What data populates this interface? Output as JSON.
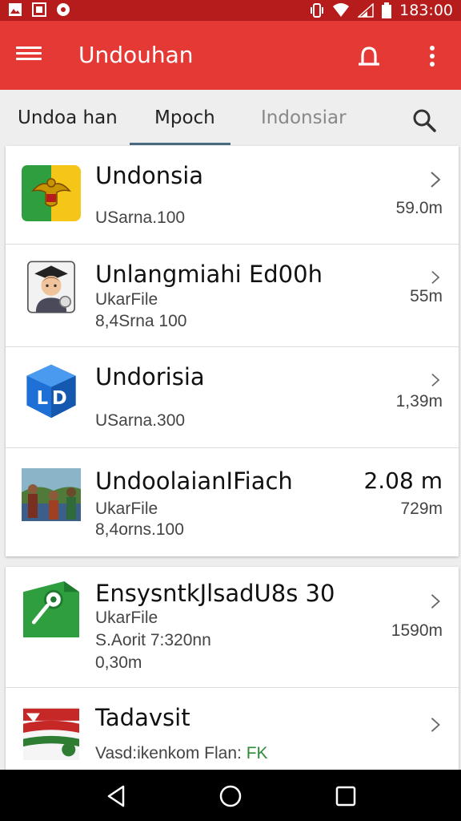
{
  "status_bar": {
    "time": "183:00",
    "left_icons": [
      "image-icon",
      "gallery-icon",
      "record-icon"
    ],
    "right_icons": [
      "vibrate-icon",
      "wifi-icon",
      "signal-icon",
      "battery-icon"
    ]
  },
  "app_bar": {
    "title": "Undouhan",
    "icons": [
      "menu-icon",
      "bell-icon",
      "more-vert-icon"
    ]
  },
  "tabs": [
    {
      "label": "Undoa han"
    },
    {
      "label": "Mpoch",
      "selected": true
    },
    {
      "label": "Indonsiar"
    }
  ],
  "colors": {
    "app_bar": "#e53935",
    "status_bar": "#b71c1c",
    "tab_indicator": "#4a6a80",
    "green_text": "#2e8b3a"
  },
  "items": [
    {
      "title": "Undonsia",
      "line1": "USarna.100",
      "size": "59.0m",
      "icon": "garuda-app-icon"
    },
    {
      "title": "Unlangmiahi Ed00h",
      "line1": "UkarFile",
      "line2": "8,4Srna 100",
      "size": "55m",
      "icon": "graduate-avatar-icon"
    },
    {
      "title": "Undorisia",
      "line1": "USarna.300",
      "size": "1,39m",
      "icon": "cube-app-icon"
    },
    {
      "title": "UndoolaianIFiach",
      "line1": "UkarFile",
      "line2": "8,4orns.100",
      "size_big": "2.08 m",
      "size": "729m",
      "icon": "people-photo-icon"
    },
    {
      "title": "EnsysntkJlsadU8s 30",
      "line1": "UkarFile",
      "line2": "S.Aorit 7:320nn",
      "line3": "0,30m",
      "size": "1590m",
      "icon": "map-pin-app-icon"
    },
    {
      "title": "Tadavsit",
      "line1_a": "Vasd:ikenkom Flan: ",
      "line1_b": "FK",
      "icon": "flag-app-icon"
    }
  ]
}
